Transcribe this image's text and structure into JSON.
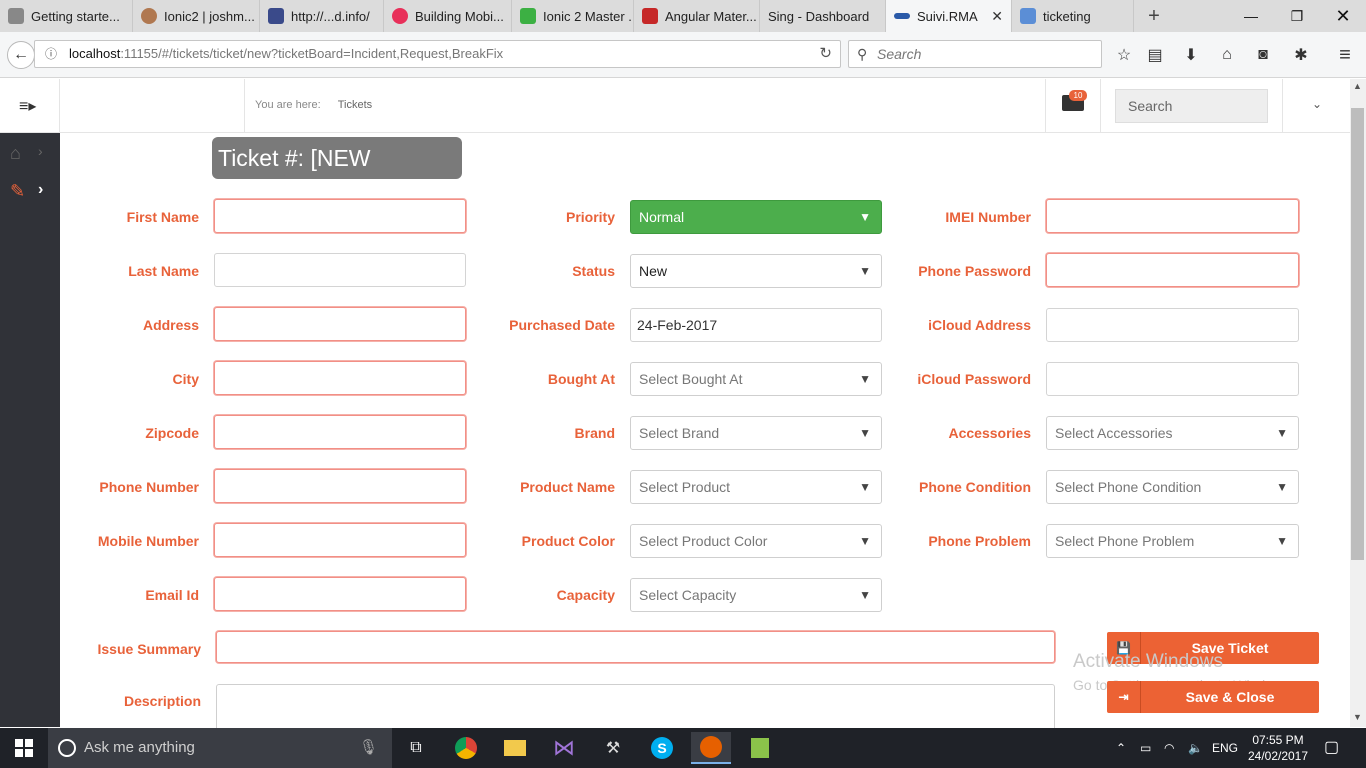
{
  "browser": {
    "tabs": [
      {
        "label": "Getting starte...",
        "color": "#888888"
      },
      {
        "label": "Ionic2 | joshm...",
        "color": "#b07850"
      },
      {
        "label": "http://...d.info/",
        "color": "#3a4a8a"
      },
      {
        "label": "Building Mobi...",
        "color": "#e8305a"
      },
      {
        "label": "Ionic 2 Master ...",
        "color": "#3cb043"
      },
      {
        "label": "Angular Mater...",
        "color": "#c62828"
      },
      {
        "label": "Sing - Dashboard",
        "color": "#dcdcdc"
      },
      {
        "label": "Suivi.RMA",
        "color": "#2a5aa8"
      },
      {
        "label": "ticketing",
        "color": "#5b8ed6"
      }
    ],
    "url_host": "localhost",
    "url_rest": ":11155/#/tickets/ticket/new?ticketBoard=Incident,Request,BreakFix",
    "search_placeholder": "Search"
  },
  "header": {
    "breadcrumb_prefix": "You are here:",
    "breadcrumb_item": "Tickets",
    "mail_badge": "10",
    "search_placeholder": "Search"
  },
  "ticket": {
    "title": "Ticket #: [NEW TICKET]"
  },
  "form": {
    "col1": {
      "first_name": "First Name",
      "last_name": "Last Name",
      "address": "Address",
      "city": "City",
      "zipcode": "Zipcode",
      "phone_number": "Phone Number",
      "mobile_number": "Mobile Number",
      "email_id": "Email Id"
    },
    "col2": {
      "priority_label": "Priority",
      "priority_value": "Normal",
      "status_label": "Status",
      "status_value": "New",
      "purchased_date_label": "Purchased Date",
      "purchased_date_value": "24-Feb-2017",
      "bought_at_label": "Bought At",
      "bought_at_placeholder": "Select Bought At",
      "brand_label": "Brand",
      "brand_placeholder": "Select Brand",
      "product_name_label": "Product Name",
      "product_name_placeholder": "Select Product",
      "product_color_label": "Product Color",
      "product_color_placeholder": "Select Product Color",
      "capacity_label": "Capacity",
      "capacity_placeholder": "Select Capacity"
    },
    "col3": {
      "imei_label": "IMEI Number",
      "phone_password_label": "Phone Password",
      "icloud_address_label": "iCloud Address",
      "icloud_password_label": "iCloud Password",
      "accessories_label": "Accessories",
      "accessories_placeholder": "Select Accessories",
      "phone_condition_label": "Phone Condition",
      "phone_condition_placeholder": "Select Phone Condition",
      "phone_problem_label": "Phone Problem",
      "phone_problem_placeholder": "Select Phone Problem"
    },
    "issue_summary_label": "Issue Summary",
    "description_label": "Description"
  },
  "actions": {
    "save_ticket": "Save Ticket",
    "save_close": "Save & Close"
  },
  "watermark": {
    "line1": "Activate Windows",
    "line2": "Go to Settings to activate Windows."
  },
  "taskbar": {
    "cortana": "Ask me anything",
    "lang": "ENG",
    "time": "07:55 PM",
    "date": "24/02/2017"
  },
  "colors": {
    "accent": "#e8623a",
    "button": "#ec6234",
    "priority_green": "#4cae4c",
    "sidebar": "#303238"
  }
}
